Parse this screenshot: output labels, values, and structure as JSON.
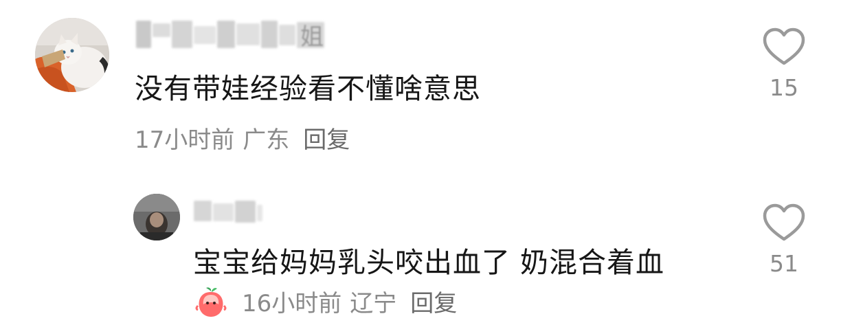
{
  "comments": [
    {
      "name_redacted": "姐",
      "text": "没有带娃经验看不懂啥意思",
      "time": "17小时前",
      "location": "广东",
      "reply_label": "回复",
      "likes": "15"
    },
    {
      "text": "宝宝给妈妈乳头咬出血了 奶混合着血",
      "time": "16小时前",
      "location": "辽宁",
      "reply_label": "回复",
      "likes": "51"
    }
  ],
  "icons": {
    "like": "heart-outline-icon",
    "badge": "peach-mascot-icon"
  },
  "colors": {
    "text_primary": "#161616",
    "text_secondary": "#8a8a8a",
    "heart_stroke": "#9a9a9a"
  }
}
